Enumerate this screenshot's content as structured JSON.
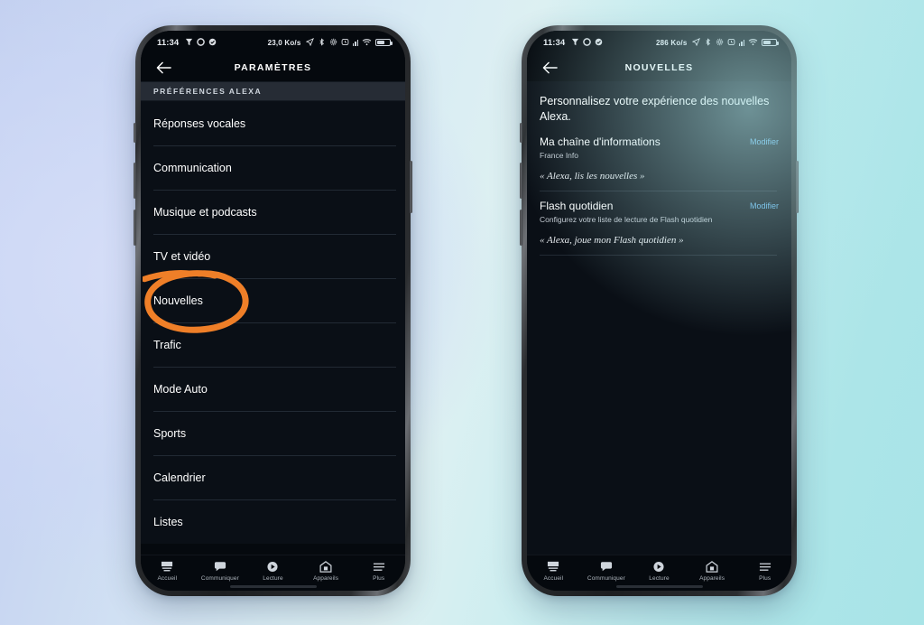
{
  "background": {
    "left_color": "#c3d0f0",
    "right_color": "#a8e4e7"
  },
  "annotation": {
    "shape": "hand-drawn-ellipse",
    "color": "#ef7f28",
    "targets": "Nouvelles"
  },
  "phones": [
    {
      "id": "settings-phone",
      "status_bar": {
        "clock": "11:34",
        "network_speed": "23,0 Ko/s",
        "left_icons": [
          "vpn-icon",
          "record-circle-icon",
          "check-circle-icon"
        ],
        "right_icons": [
          "location-icon",
          "bluetooth-icon",
          "settings-gear-icon",
          "alarm-icon",
          "signal-bars-icon",
          "wifi-icon",
          "battery-icon"
        ]
      },
      "header": {
        "back_label": "←",
        "title": "PARAMÈTRES"
      },
      "section_header": "PRÉFÉRENCES ALEXA",
      "list_items": [
        {
          "label": "Réponses vocales"
        },
        {
          "label": "Communication"
        },
        {
          "label": "Musique et podcasts"
        },
        {
          "label": "TV et vidéo"
        },
        {
          "label": "Nouvelles"
        },
        {
          "label": "Trafic"
        },
        {
          "label": "Mode Auto"
        },
        {
          "label": "Sports"
        },
        {
          "label": "Calendrier"
        },
        {
          "label": "Listes"
        }
      ],
      "tabs": [
        {
          "label": "Accueil",
          "icon": "home-icon"
        },
        {
          "label": "Communiquer",
          "icon": "chat-bubble-icon"
        },
        {
          "label": "Lecture",
          "icon": "play-circle-icon"
        },
        {
          "label": "Appareils",
          "icon": "devices-house-icon"
        },
        {
          "label": "Plus",
          "icon": "hamburger-menu-icon"
        }
      ]
    },
    {
      "id": "news-phone",
      "status_bar": {
        "clock": "11:34",
        "network_speed": "286 Ko/s",
        "left_icons": [
          "vpn-icon",
          "record-circle-icon",
          "check-circle-icon"
        ],
        "right_icons": [
          "location-icon",
          "bluetooth-icon",
          "settings-gear-icon",
          "alarm-icon",
          "signal-bars-icon",
          "wifi-icon",
          "battery-icon"
        ]
      },
      "header": {
        "back_label": "←",
        "title": "NOUVELLES"
      },
      "intro": "Personnalisez votre expérience des nouvelles Alexa.",
      "blocks": [
        {
          "title": "Ma chaîne d'informations",
          "subtitle": "France Info",
          "edit_label": "Modifier",
          "quote": "« Alexa, lis les nouvelles »"
        },
        {
          "title": "Flash quotidien",
          "subtitle": "Configurez votre liste de lecture de Flash quotidien",
          "edit_label": "Modifier",
          "quote": "« Alexa, joue mon Flash quotidien »"
        }
      ],
      "tabs": [
        {
          "label": "Accueil",
          "icon": "home-icon"
        },
        {
          "label": "Communiquer",
          "icon": "chat-bubble-icon"
        },
        {
          "label": "Lecture",
          "icon": "play-circle-icon"
        },
        {
          "label": "Appareils",
          "icon": "devices-house-icon"
        },
        {
          "label": "Plus",
          "icon": "hamburger-menu-icon"
        }
      ]
    }
  ]
}
